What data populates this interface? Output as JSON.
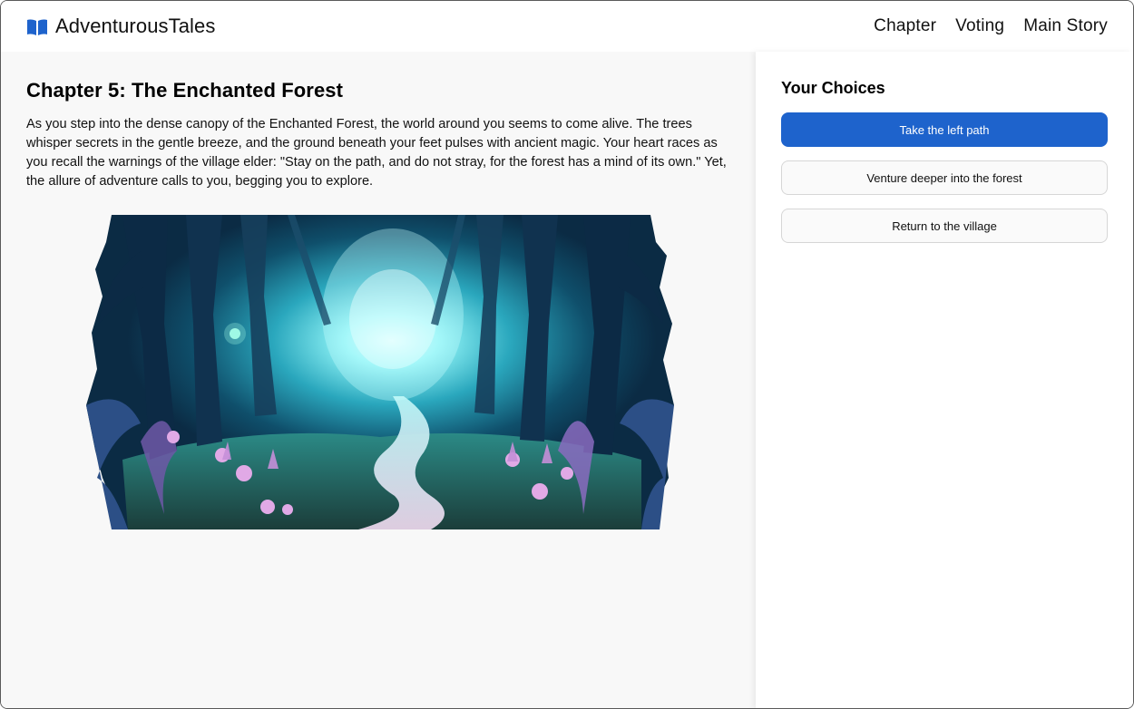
{
  "header": {
    "brand": "AdventurousTales",
    "brand_icon": "open-book-icon",
    "nav": [
      "Chapter",
      "Voting",
      "Main Story"
    ]
  },
  "chapter": {
    "title": "Chapter 5: The Enchanted Forest",
    "body": "As you step into the dense canopy of the Enchanted Forest, the world around you seems to come alive. The trees whisper secrets in the gentle breeze, and the ground beneath your feet pulses with ancient magic. Your heart races as you recall the warnings of the village elder: \"Stay on the path, and do not stray, for the forest has a mind of its own.\" Yet, the allure of adventure calls to you, begging you to explore."
  },
  "choices": {
    "title": "Your Choices",
    "items": [
      {
        "label": "Take the left path",
        "selected": true
      },
      {
        "label": "Venture deeper into the forest",
        "selected": false
      },
      {
        "label": "Return to the village",
        "selected": false
      }
    ]
  },
  "colors": {
    "accent": "#1e63cc",
    "main_bg": "#f8f8f8"
  }
}
